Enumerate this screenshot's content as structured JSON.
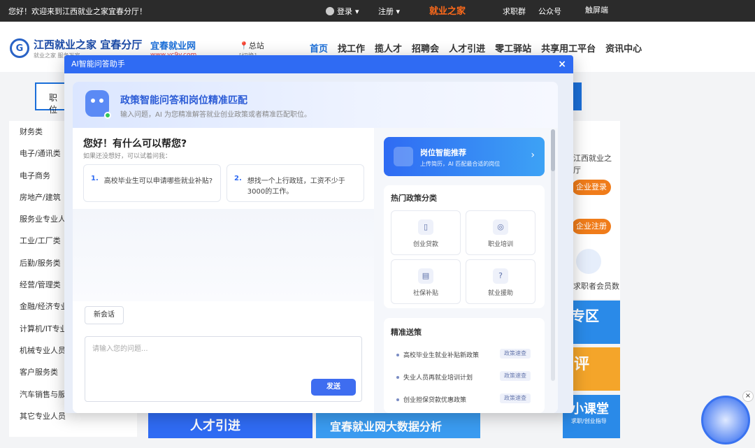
{
  "topbar": {
    "welcome": "您好！欢迎来到江西就业之家宜春分厅！",
    "login": "登录",
    "register": "注册",
    "brand": "就业之家",
    "links": [
      "求职群",
      "公众号",
      "触屏端"
    ]
  },
  "header": {
    "logo_title": "江西就业之家 宜春分厅",
    "logo_sub": "就业之家 服务万家",
    "site2_title": "宜春就业网",
    "site2_url": "www.yc9y.com",
    "location": "总站",
    "location_sub": "[切换]",
    "nav": [
      "首页",
      "找工作",
      "揽人才",
      "招聘会",
      "人才引进",
      "零工驿站",
      "共享用工平台",
      "资讯中心"
    ]
  },
  "search": {
    "type_label": "职 位"
  },
  "categories": [
    "财务类",
    "电子/通讯类",
    "电子商务",
    "房地产/建筑",
    "服务业专业人",
    "工业/工厂类",
    "后勤/服务类",
    "经营/管理类",
    "金融/经济专业",
    "计算机/IT专业",
    "机械专业人员",
    "客户服务类",
    "汽车销售与服",
    "其它专业人员"
  ],
  "right_panel": {
    "text1": "江西就业之",
    "text2": "厅",
    "btn_login": "企业登录",
    "btn_register": "企业注册",
    "member_label": "求职者会员数",
    "banner1": "专区",
    "banner2": "评",
    "banner3": "小课堂",
    "banner3_sub": "求职/创业指导"
  },
  "bottom_ads": [
    "人才引进",
    "宜春就业网大数据分析"
  ],
  "modal": {
    "title": "AI智能问答助手",
    "close": "×",
    "head_title": "政策智能问答和岗位精准匹配",
    "head_sub": "输入问题，AI 为您精准解答就业创业政策或者精准匹配职位。",
    "greeting": "您好！有什么可以帮您?",
    "greeting_sub": "如果还没想好，可以试着问我：",
    "suggestions": [
      {
        "num": "1.",
        "text": "高校毕业生可以申请哪些就业补贴?"
      },
      {
        "num": "2.",
        "text": "想找一个上行政班，工资不少于3000的工作。"
      }
    ],
    "new_chat": "新会话",
    "input_placeholder": "请输入您的问题...",
    "send": "发送",
    "job_card": {
      "title": "岗位智能推荐",
      "sub": "上传简历，AI 匹配最合适的岗位"
    },
    "hot_title": "热门政策分类",
    "hot_tiles": [
      {
        "label": "创业贷款",
        "icon": "book-icon"
      },
      {
        "label": "职业培训",
        "icon": "compass-icon"
      },
      {
        "label": "社保补贴",
        "icon": "document-icon"
      },
      {
        "label": "就业援助",
        "icon": "help-icon"
      }
    ],
    "precise_title": "精准送策",
    "precise_items": [
      {
        "text": "高校毕业生就业补贴新政策",
        "tag": "政策速查"
      },
      {
        "text": "失业人员再就业培训计划",
        "tag": "政策速查"
      },
      {
        "text": "创业担保贷款优惠政策",
        "tag": "政策速查"
      }
    ]
  }
}
